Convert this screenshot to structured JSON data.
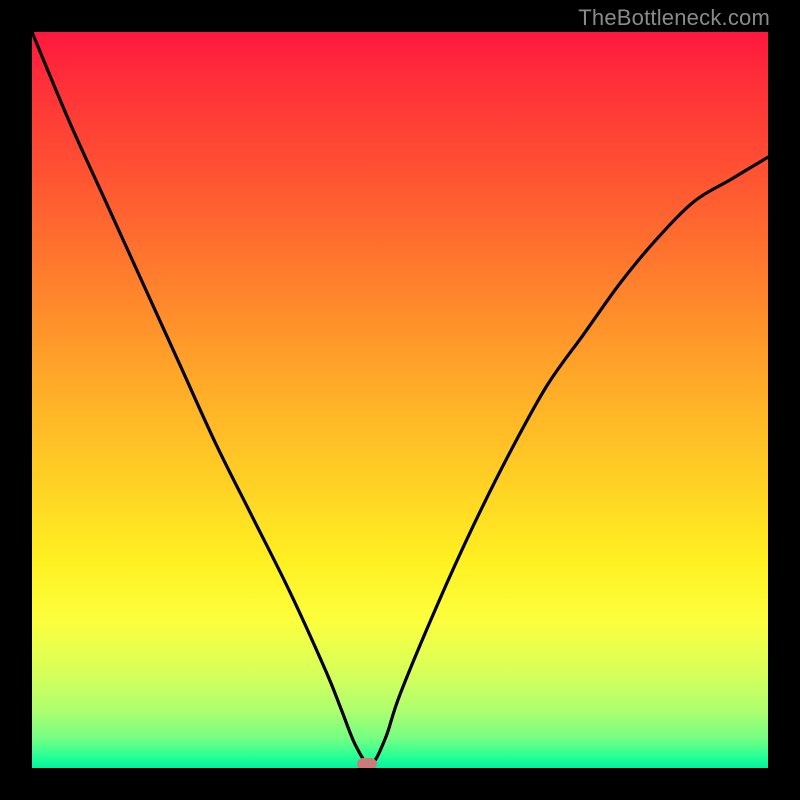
{
  "watermark": "TheBottleneck.com",
  "colors": {
    "frame": "#000000",
    "gradient_stops": [
      {
        "pct": 0,
        "hex": "#ff173e"
      },
      {
        "pct": 6,
        "hex": "#ff2d3a"
      },
      {
        "pct": 15,
        "hex": "#ff4634"
      },
      {
        "pct": 27,
        "hex": "#ff6a2f"
      },
      {
        "pct": 38,
        "hex": "#ff8c2b"
      },
      {
        "pct": 48,
        "hex": "#ffab28"
      },
      {
        "pct": 61,
        "hex": "#ffd024"
      },
      {
        "pct": 72,
        "hex": "#fff122"
      },
      {
        "pct": 80,
        "hex": "#fcff3d"
      },
      {
        "pct": 87,
        "hex": "#d8ff5a"
      },
      {
        "pct": 92,
        "hex": "#b0ff6e"
      },
      {
        "pct": 96,
        "hex": "#74ff83"
      },
      {
        "pct": 98.5,
        "hex": "#26ff97"
      },
      {
        "pct": 100,
        "hex": "#00f59c"
      }
    ],
    "curve": "#000000",
    "marker": "#cc7a7a"
  },
  "chart_data": {
    "type": "line",
    "title": "",
    "xlabel": "",
    "ylabel": "",
    "xlim": [
      0,
      1
    ],
    "ylim": [
      0,
      1
    ],
    "x": [
      0.0,
      0.05,
      0.1,
      0.15,
      0.2,
      0.25,
      0.3,
      0.35,
      0.4,
      0.42,
      0.44,
      0.46,
      0.48,
      0.5,
      0.55,
      0.6,
      0.65,
      0.7,
      0.75,
      0.8,
      0.85,
      0.9,
      0.95,
      1.0
    ],
    "values": [
      1.0,
      0.88,
      0.77,
      0.66,
      0.55,
      0.44,
      0.34,
      0.24,
      0.13,
      0.08,
      0.03,
      0.005,
      0.04,
      0.1,
      0.22,
      0.33,
      0.43,
      0.52,
      0.59,
      0.66,
      0.72,
      0.77,
      0.8,
      0.83
    ],
    "marker": {
      "x": 0.455,
      "y": 0.005
    }
  }
}
